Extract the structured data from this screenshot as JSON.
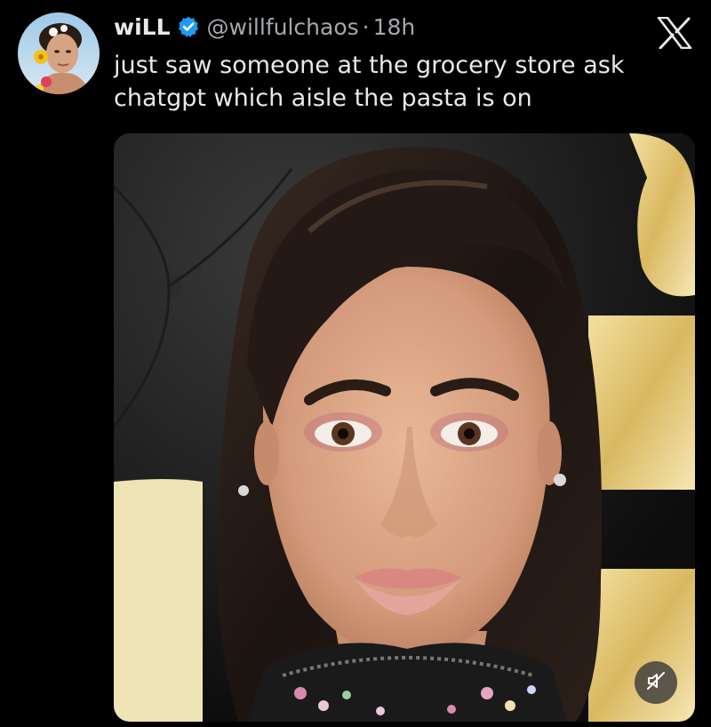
{
  "tweet": {
    "display_name": "wiLL",
    "handle": "@willfulchaos",
    "separator": "·",
    "time": "18h",
    "text": "just saw someone at the grocery store ask chatgpt which aisle the pasta is on",
    "verified": true
  },
  "icons": {
    "avatar": "profile-photo",
    "verified": "verified-badge-icon",
    "platform": "x-logo-icon",
    "mute": "speaker-muted-icon"
  },
  "colors": {
    "background": "#000000",
    "text": "#e7e9ea",
    "secondary_text": "#a4a9ae",
    "verified_blue": "#1d9bf0"
  }
}
